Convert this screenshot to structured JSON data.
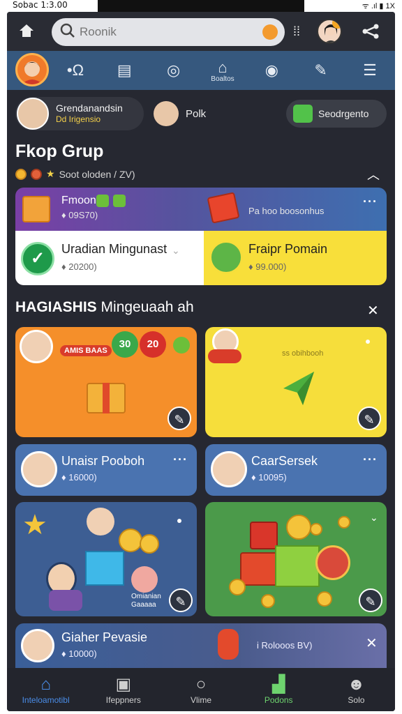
{
  "status_bar": {
    "time": "Sobac 1:3.00",
    "right": "ᯤ .ıl ▮ 1X"
  },
  "top_bar": {
    "search_placeholder": "Roonik",
    "icons": [
      "home-icon",
      "search-icon",
      "mic-icon",
      "qr-icon",
      "avatar",
      "share-icon"
    ]
  },
  "nav": {
    "items": [
      {
        "icon": "•Ω",
        "label": ""
      },
      {
        "icon": "▤",
        "label": ""
      },
      {
        "icon": "◎",
        "label": ""
      },
      {
        "icon": "⌂",
        "label": "Boaltos"
      },
      {
        "icon": "◉",
        "label": ""
      },
      {
        "icon": "✎",
        "label": ""
      },
      {
        "icon": "☰",
        "label": ""
      }
    ]
  },
  "chips": {
    "user_name": "Grendanandsin",
    "user_sub": "Dd Irigensio",
    "second": "Polk",
    "third": "Seodrgento"
  },
  "section1": {
    "title": "Fkop Grup",
    "subtitle": "Soot oloden / ZV)"
  },
  "promo": {
    "top_left_title": "Fmoon",
    "top_left_sub": "♦ 09S70)",
    "top_right_text": "Pa hoo boosonhus",
    "bottom_left_title": "Uradian Mingunast",
    "bottom_left_sub": "♦ 20200)",
    "bottom_right_title": "Fraipr Pomain",
    "bottom_right_sub": "♦ 99.000)"
  },
  "section2": {
    "title_bold": "HAGIASHIS",
    "title_rest": "Mingeuaah ah"
  },
  "cards": {
    "orange_badge": "AMIS BAAS",
    "ball1": "30",
    "ball2": "20",
    "yellow_text": "ss obihbooh",
    "row_left_title": "Unaisr Pooboh",
    "row_left_sub": "♦ 16000)",
    "row_right_title": "CaarSersek",
    "row_right_sub": "♦ 10095)",
    "art_left_caption": "Omianian Gaaaaa",
    "bottom_title": "Giaher Pevasie",
    "bottom_sub": "♦ 10000)",
    "bottom_right_text": "i Rolooos BV)"
  },
  "bottom_nav": [
    {
      "icon": "⌂",
      "label": "Inteloamotibl",
      "state": "active"
    },
    {
      "icon": "▣",
      "label": "Ifeppners",
      "state": ""
    },
    {
      "icon": "○",
      "label": "Vlime",
      "state": ""
    },
    {
      "icon": "▟",
      "label": "Podons",
      "state": "green"
    },
    {
      "icon": "☻",
      "label": "Solo",
      "state": ""
    }
  ],
  "colors": {
    "background": "#262831",
    "nav_bar": "#36587e",
    "orange_card": "#f58f2a",
    "yellow_card": "#f6de3b",
    "blue_row": "#4a73b0",
    "green_card": "#4b9a4a",
    "active_tab": "#4a8de8"
  }
}
